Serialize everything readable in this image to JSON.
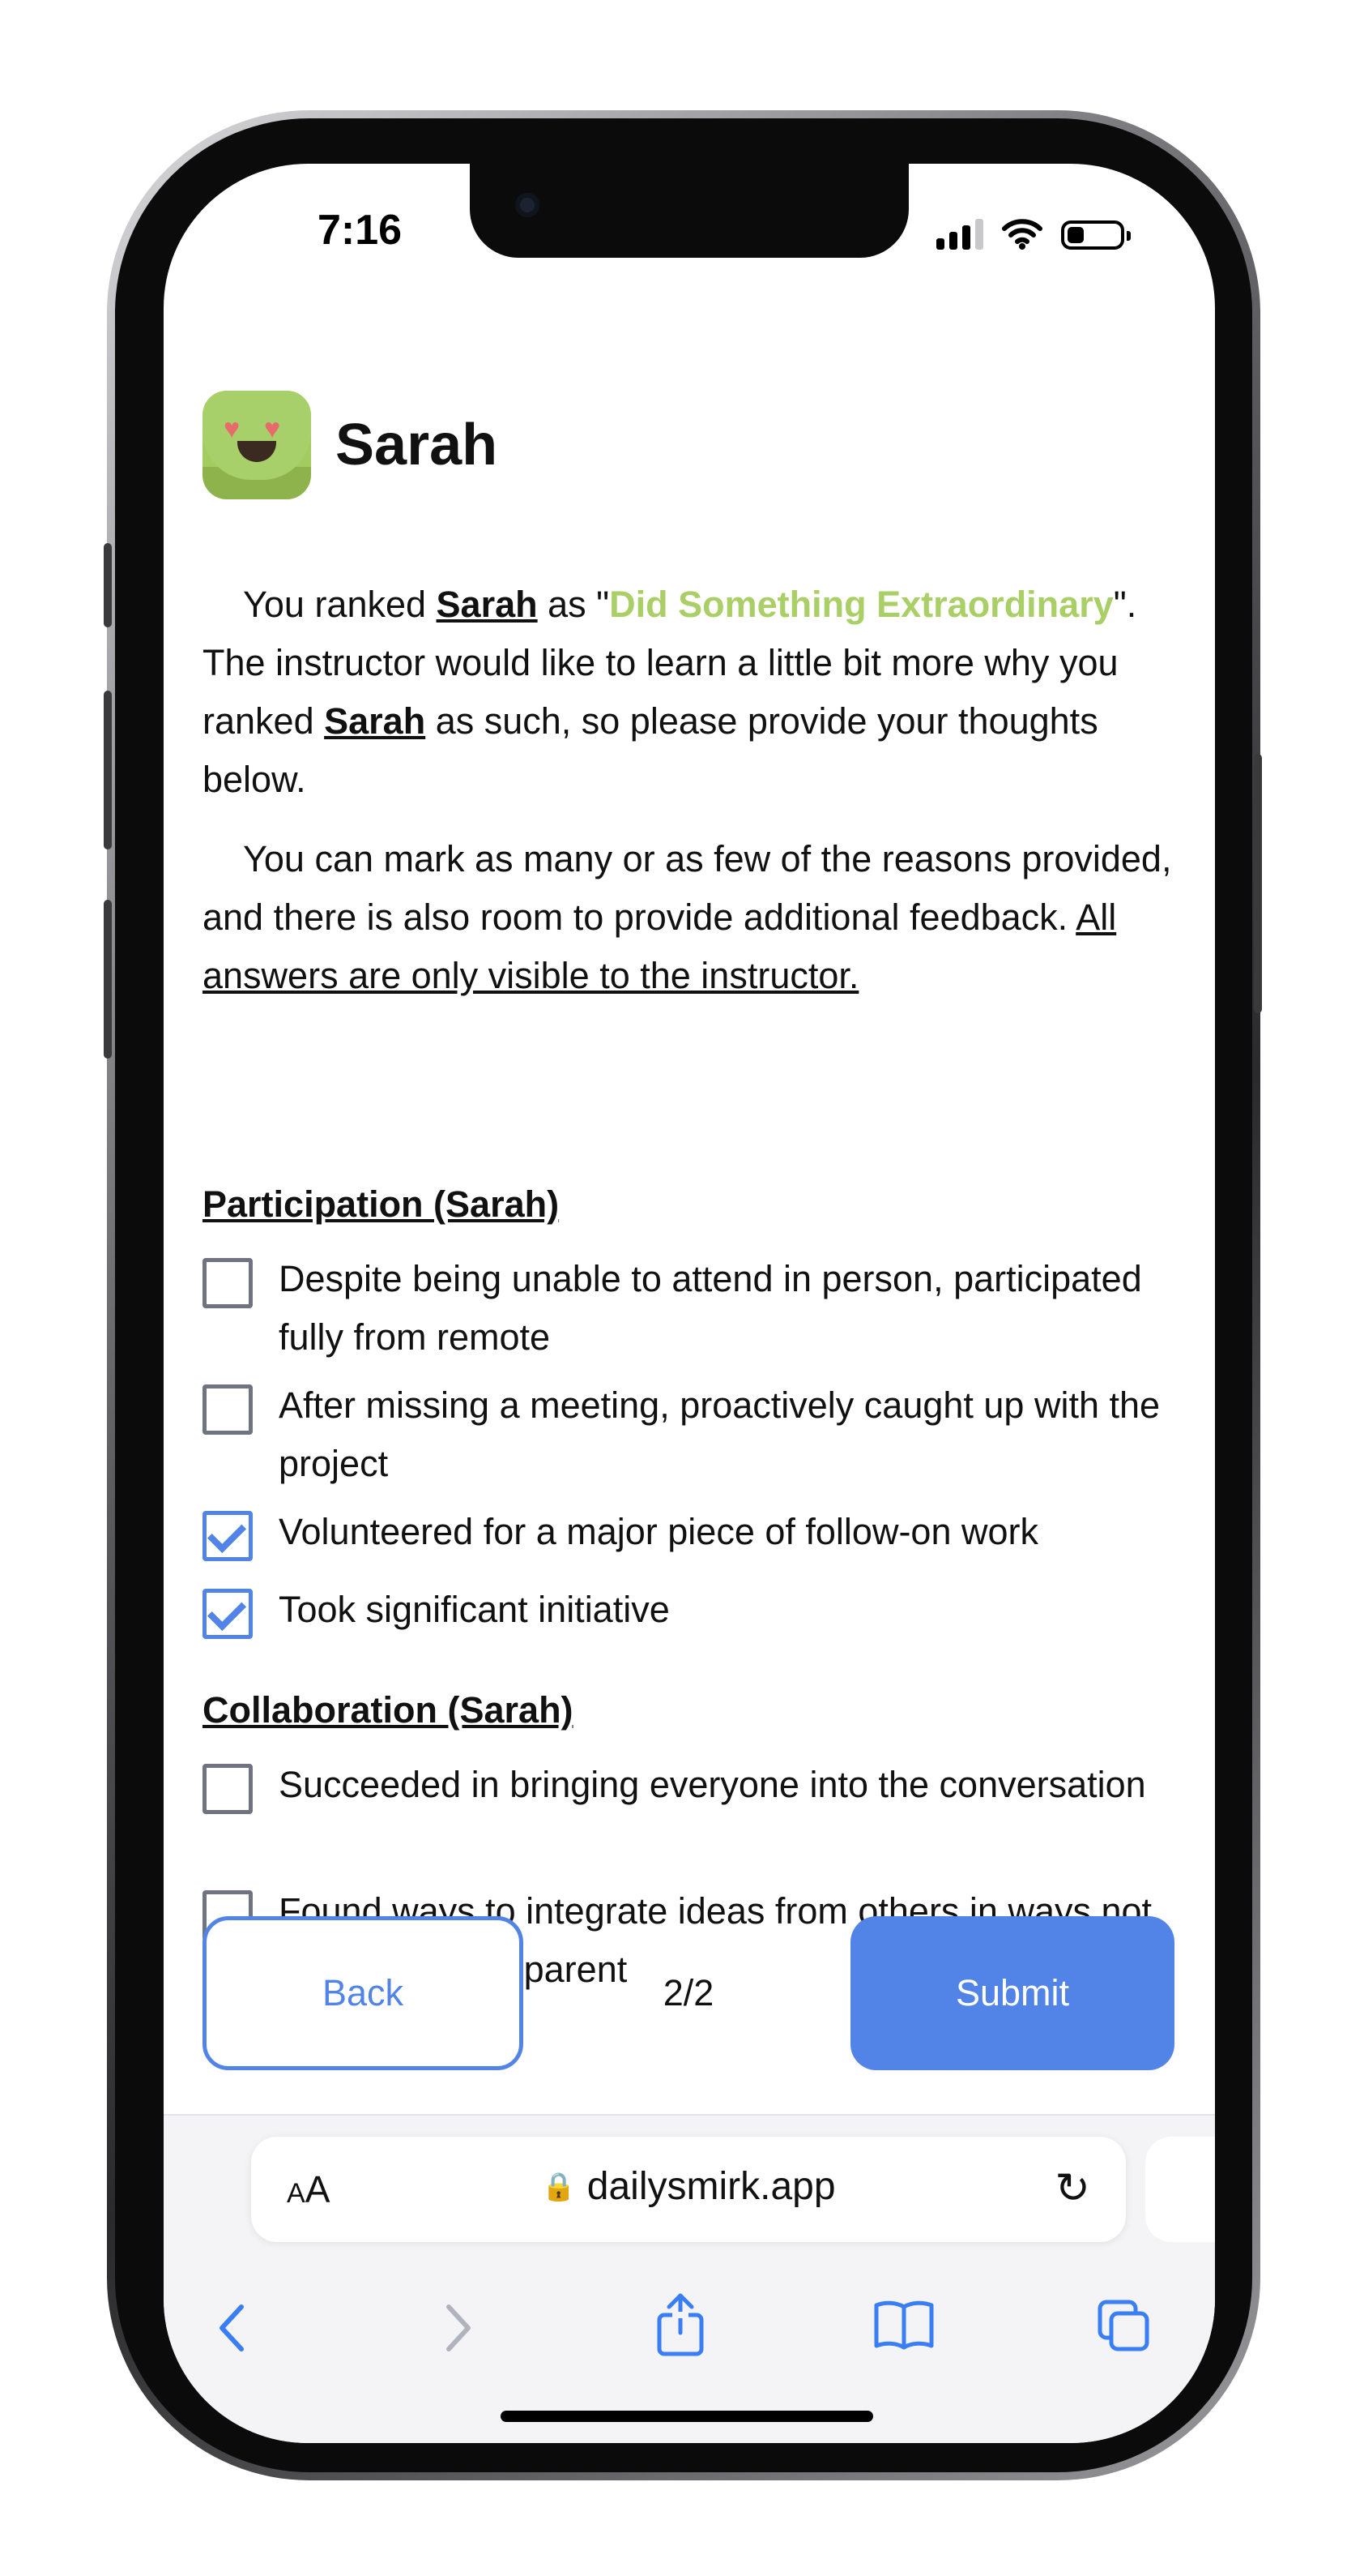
{
  "status": {
    "time": "7:16"
  },
  "header": {
    "name": "Sarah"
  },
  "intro": {
    "p1_a": "You ranked ",
    "p1_name1": "Sarah",
    "p1_b": " as \"",
    "p1_rank": "Did Something Extraordinary",
    "p1_c": "\". The instructor would like to learn a little bit more why you ranked ",
    "p1_name2": "Sarah",
    "p1_d": " as such, so please provide your thoughts below.",
    "p2_a": "You can mark as many or as few of the reasons provided, and there is also room to provide additional feedback. ",
    "p2_note": "All answers are only visible to the instructor."
  },
  "sections": [
    {
      "title": "Participation (Sarah)",
      "options": [
        {
          "label": "Despite being unable to attend in person, participated fully from remote",
          "checked": false
        },
        {
          "label": "After missing a meeting, proactively caught up with the project",
          "checked": false
        },
        {
          "label": "Volunteered for a major piece of follow-on work",
          "checked": true
        },
        {
          "label": "Took significant initiative",
          "checked": true
        }
      ]
    },
    {
      "title": "Collaboration (Sarah)",
      "options": [
        {
          "label": "Succeeded in bringing everyone into the conversation",
          "checked": false
        },
        {
          "label": "Found ways to integrate ideas from others in ways not immediately apparent",
          "checked": false
        }
      ]
    }
  ],
  "nav": {
    "back_label": "Back",
    "page_indicator": "2/2",
    "submit_label": "Submit"
  },
  "browser": {
    "text_size_label": "AA",
    "url": "dailysmirk.app"
  },
  "colors": {
    "accent": "#5284e8",
    "highlight": "#a9cf66"
  },
  "icons": {
    "avatar": "heart-eyes-face-icon",
    "toolbar": [
      "back-arrow-icon",
      "forward-arrow-icon",
      "share-icon",
      "bookmarks-icon",
      "tabs-icon"
    ]
  }
}
